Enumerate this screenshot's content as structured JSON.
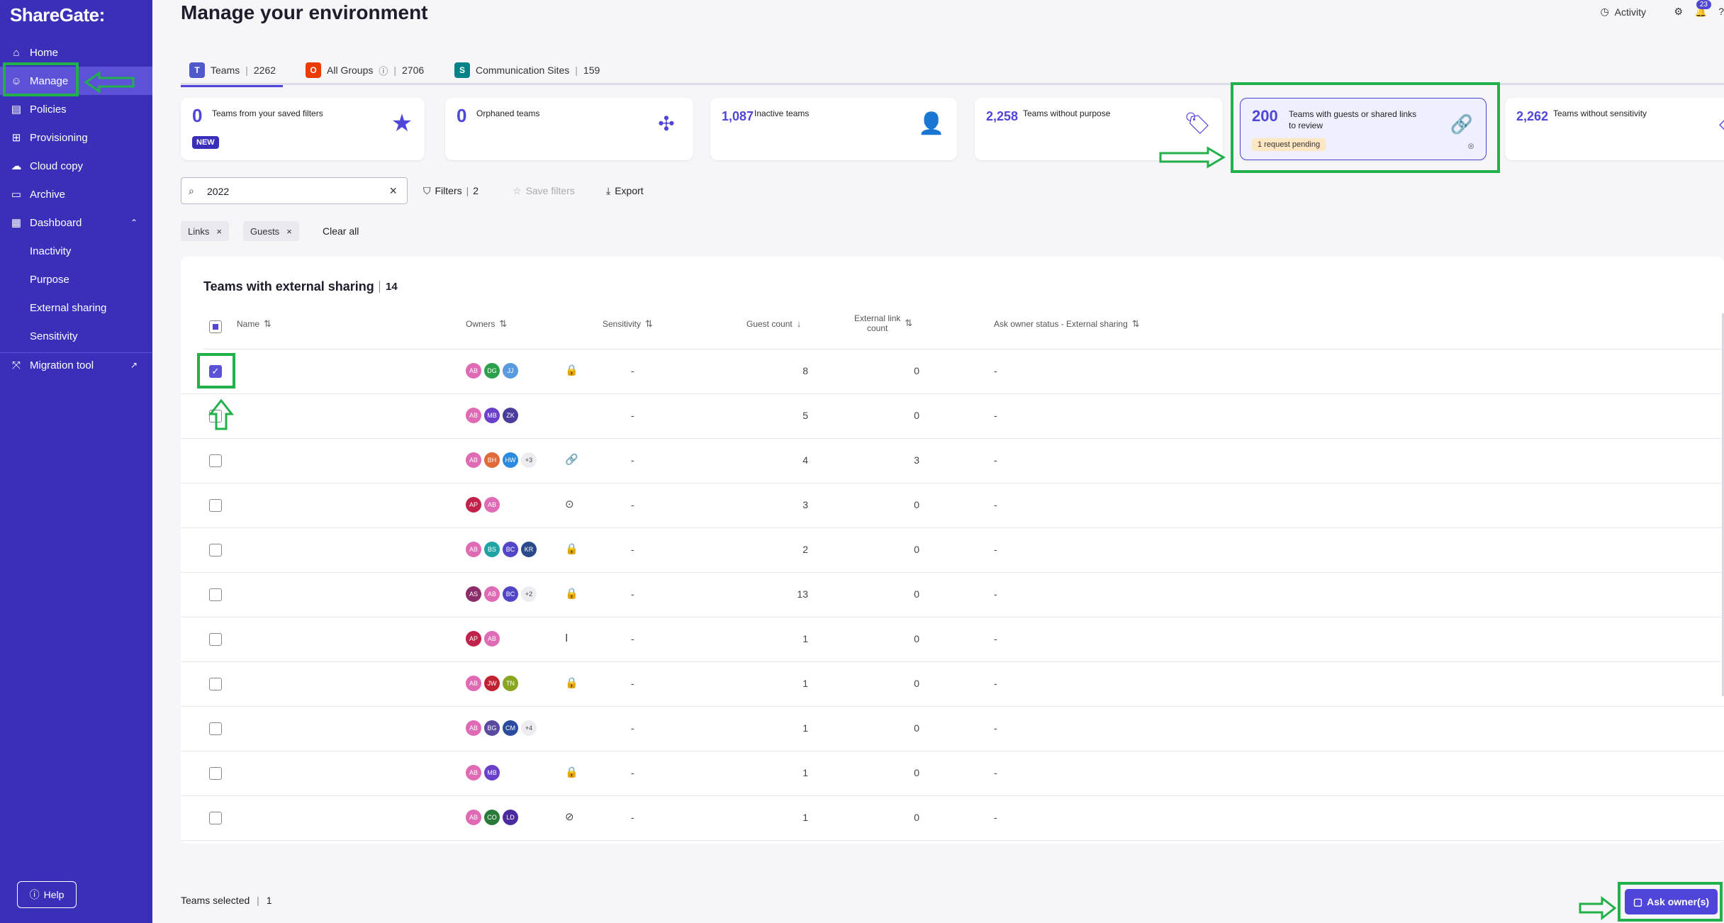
{
  "app": {
    "logo": "ShareGate:"
  },
  "sidebar": {
    "items": [
      {
        "label": "Home",
        "icon": "home-icon"
      },
      {
        "label": "Manage",
        "icon": "manage-icon"
      },
      {
        "label": "Policies",
        "icon": "policies-icon"
      },
      {
        "label": "Provisioning",
        "icon": "provisioning-icon"
      },
      {
        "label": "Cloud copy",
        "icon": "cloud-icon"
      },
      {
        "label": "Archive",
        "icon": "archive-icon"
      },
      {
        "label": "Dashboard",
        "icon": "dashboard-icon"
      },
      {
        "label": "Inactivity"
      },
      {
        "label": "Purpose"
      },
      {
        "label": "External sharing"
      },
      {
        "label": "Sensitivity"
      },
      {
        "label": "Migration tool",
        "icon": "migration-icon"
      }
    ],
    "help": "Help"
  },
  "header": {
    "title": "Manage your environment",
    "activity": "Activity",
    "notifications": "23"
  },
  "tabs": [
    {
      "label": "Teams",
      "count": "2262"
    },
    {
      "label": "All Groups",
      "count": "2706"
    },
    {
      "label": "Communication Sites",
      "count": "159"
    }
  ],
  "cards": [
    {
      "num": "0",
      "label": "Teams from your saved filters",
      "badge": "NEW"
    },
    {
      "num": "0",
      "label": "Orphaned teams"
    },
    {
      "num": "1,087",
      "label": "Inactive teams"
    },
    {
      "num": "2,258",
      "label": "Teams without purpose"
    },
    {
      "num": "200",
      "label": "Teams with guests or shared links to review",
      "badge": "1 request pending"
    },
    {
      "num": "2,262",
      "label": "Teams without sensitivity"
    }
  ],
  "toolbar": {
    "search_value": "2022",
    "filters": "Filters",
    "filters_count": "2",
    "save_filters": "Save filters",
    "export": "Export"
  },
  "chips": [
    "Links",
    "Guests"
  ],
  "clear_all": "Clear all",
  "table": {
    "title": "Teams with external sharing",
    "count": "14",
    "columns": {
      "name": "Name",
      "owners": "Owners",
      "sensitivity": "Sensitivity",
      "guest_count": "Guest count",
      "external_link_count_1": "External link",
      "external_link_count_2": "count",
      "ask_owner": "Ask owner status - External sharing"
    },
    "rows": [
      {
        "checked": true,
        "owners": [
          "AB",
          "DG",
          "JJ"
        ],
        "sensitivity": "-",
        "guests": "8",
        "links": "0",
        "status": "-"
      },
      {
        "checked": false,
        "owners": [
          "AB",
          "MB",
          "ZK"
        ],
        "sensitivity": "-",
        "guests": "5",
        "links": "0",
        "status": "-"
      },
      {
        "checked": false,
        "owners": [
          "AB",
          "BH",
          "HW",
          "+3"
        ],
        "sensitivity": "-",
        "guests": "4",
        "links": "3",
        "status": "-"
      },
      {
        "checked": false,
        "owners": [
          "AP",
          "AB"
        ],
        "sensitivity": "-",
        "guests": "3",
        "links": "0",
        "status": "-"
      },
      {
        "checked": false,
        "owners": [
          "AB",
          "BS",
          "BC",
          "KR"
        ],
        "sensitivity": "-",
        "guests": "2",
        "links": "0",
        "status": "-"
      },
      {
        "checked": false,
        "owners": [
          "AS",
          "AB",
          "BC",
          "+2"
        ],
        "sensitivity": "-",
        "guests": "13",
        "links": "0",
        "status": "-"
      },
      {
        "checked": false,
        "owners": [
          "AP",
          "AB"
        ],
        "sensitivity": "-",
        "guests": "1",
        "links": "0",
        "status": "-"
      },
      {
        "checked": false,
        "owners": [
          "AB",
          "JW",
          "TN"
        ],
        "sensitivity": "-",
        "guests": "1",
        "links": "0",
        "status": "-"
      },
      {
        "checked": false,
        "owners": [
          "AB",
          "BG",
          "CM",
          "+4"
        ],
        "sensitivity": "-",
        "guests": "1",
        "links": "0",
        "status": "-"
      },
      {
        "checked": false,
        "owners": [
          "AB",
          "MB"
        ],
        "sensitivity": "-",
        "guests": "1",
        "links": "0",
        "status": "-"
      },
      {
        "checked": false,
        "owners": [
          "AB",
          "CO",
          "LD"
        ],
        "sensitivity": "-",
        "guests": "1",
        "links": "0",
        "status": "-"
      }
    ]
  },
  "footer": {
    "selected_label": "Teams selected",
    "selected_count": "1",
    "ask_button": "Ask owner(s)"
  },
  "colors": {
    "sidebar": "#3a2fb9",
    "accent": "#4f46d9",
    "annotation": "#22b04b"
  }
}
